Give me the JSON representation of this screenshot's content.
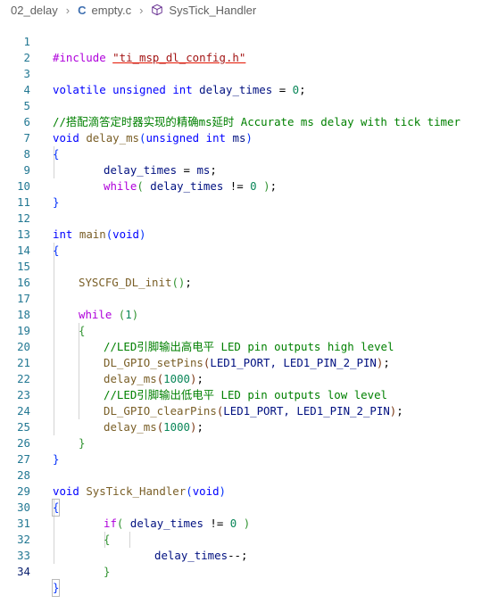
{
  "breadcrumb": {
    "folder": "02_delay",
    "file_icon": "C",
    "file": "empty.c",
    "symbol_icon": "cube-icon",
    "symbol": "SysTick_Handler"
  },
  "line_numbers": [
    "1",
    "2",
    "3",
    "4",
    "5",
    "6",
    "7",
    "8",
    "9",
    "10",
    "11",
    "12",
    "13",
    "14",
    "15",
    "16",
    "17",
    "18",
    "19",
    "20",
    "21",
    "22",
    "23",
    "24",
    "25",
    "26",
    "27",
    "28",
    "29",
    "30",
    "31",
    "32",
    "33",
    "34"
  ],
  "code": {
    "l1_directive": "#include",
    "l1_path": "\"ti_msp_dl_config.h\"",
    "l3_volatile": "volatile",
    "l3_unsigned": "unsigned",
    "l3_int": "int",
    "l3_var": "delay_times",
    "l3_eq": " = ",
    "l3_num": "0",
    "l3_semi": ";",
    "l5_comment": "//搭配滴答定时器实现的精确ms延时 Accurate ms delay with tick timer",
    "l6_void": "void",
    "l6_fn": "delay_ms",
    "l6_unsigned": "unsigned",
    "l6_int": "int",
    "l6_param": "ms",
    "l8_var": "delay_times",
    "l8_rest": " = ",
    "l8_param": "ms",
    "l9_while": "while",
    "l9_var": "delay_times",
    "l9_op": " != ",
    "l9_num": "0",
    "l12_int": "int",
    "l12_fn": "main",
    "l12_void": "void",
    "l15_fn": "SYSCFG_DL_init",
    "l17_while": "while",
    "l17_num": "1",
    "l19_comment": "//LED引脚输出高电平 LED pin outputs high level",
    "l20_fn": "DL_GPIO_setPins",
    "l20_args": "LED1_PORT, LED1_PIN_2_PIN",
    "l21_fn": "delay_ms",
    "l21_num": "1000",
    "l22_comment": "//LED引脚输出低电平 LED pin outputs low level",
    "l23_fn": "DL_GPIO_clearPins",
    "l23_args": "LED1_PORT, LED1_PIN_2_PIN",
    "l24_fn": "delay_ms",
    "l24_num": "1000",
    "l28_void": "void",
    "l28_fn": "SysTick_Handler",
    "l28_param": "void",
    "l30_if": "if",
    "l30_var": "delay_times",
    "l30_op": " != ",
    "l30_num": "0",
    "l32_var": "delay_times",
    "l32_op": "--;"
  },
  "active_line": "34",
  "colors": {
    "keyword": "#0000ff",
    "control": "#af00db",
    "function": "#795e26",
    "number": "#098658",
    "string": "#a31515",
    "comment": "#008000",
    "line_number": "#237893"
  }
}
